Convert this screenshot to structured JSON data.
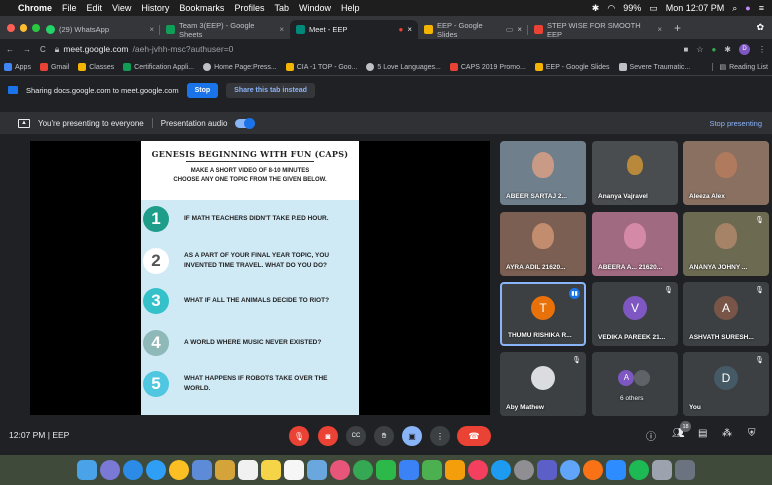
{
  "menubar": {
    "apple": "",
    "app": "Chrome",
    "items": [
      "File",
      "Edit",
      "View",
      "History",
      "Bookmarks",
      "Profiles",
      "Tab",
      "Window",
      "Help"
    ],
    "battery": "99%",
    "clock": "Mon 12:07 PM"
  },
  "tabs": [
    {
      "label": "(29) WhatsApp",
      "color": "#25d366"
    },
    {
      "label": "Team 3(EEP) - Google Sheets",
      "color": "#0f9d58"
    },
    {
      "label": "Meet - EEP",
      "color": "#00897b"
    },
    {
      "label": "EEP - Google Slides",
      "color": "#f4b400"
    },
    {
      "label": "STEP WISE FOR SMOOTH EEP",
      "color": "#ea4335"
    }
  ],
  "address": {
    "host": "meet.google.com",
    "path": "/aeh-jvhh-msc?authuser=0"
  },
  "bookmarks": [
    {
      "label": "Apps",
      "color": "#4285f4"
    },
    {
      "label": "Gmail",
      "color": "#ea4335"
    },
    {
      "label": "Classes",
      "color": "#f4b400"
    },
    {
      "label": "Certification Appli...",
      "color": "#0f9d58"
    },
    {
      "label": "Home Page:Press...",
      "color": "#bdc1c6"
    },
    {
      "label": "CIA -1 TOP - Goo...",
      "color": "#f4b400"
    },
    {
      "label": "5 Love Languages...",
      "color": "#bdc1c6"
    },
    {
      "label": "CAPS 2019 Promo...",
      "color": "#ea4335"
    },
    {
      "label": "EEP - Google Slides",
      "color": "#f4b400"
    },
    {
      "label": "Severe Traumatic...",
      "color": "#bdc1c6"
    }
  ],
  "reading_list": "Reading List",
  "sharing": {
    "text": "Sharing docs.google.com to meet.google.com",
    "stop": "Stop",
    "share_tab": "Share this tab instead"
  },
  "banner": {
    "presenting": "You're presenting to everyone",
    "audio": "Presentation audio",
    "stop": "Stop presenting"
  },
  "slide": {
    "title": "GENESIS BEGINNING WITH FUN (CAPS)",
    "sub1": "MAKE A SHORT VIDEO OF 8-10 MINUTES",
    "sub2": "CHOOSE ANY ONE TOPIC FROM THE GIVEN BELOW.",
    "items": [
      {
        "num": "1",
        "text": "IF MATH TEACHERS DIDN'T TAKE P.ED HOUR.",
        "color": "#1e9d8b"
      },
      {
        "num": "2",
        "text": "AS A PART OF YOUR FINAL YEAR TOPIC, YOU INVENTED TIME TRAVEL. WHAT DO YOU DO?",
        "color": "#ffffff"
      },
      {
        "num": "3",
        "text": "WHAT IF ALL THE ANIMALS DECIDE TO RIOT?",
        "color": "#35c1c9"
      },
      {
        "num": "4",
        "text": "A WORLD WHERE MUSIC NEVER EXISTED?",
        "color": "#8fb8b9"
      },
      {
        "num": "5",
        "text": "WHAT HAPPENS IF ROBOTS TAKE OVER THE WORLD.",
        "color": "#4fc7e0"
      }
    ]
  },
  "participants": [
    {
      "name": "ABEER SARTAJ 2...",
      "bg": "#6f7f8c",
      "kind": "video"
    },
    {
      "name": "Ananya Vajravel",
      "bg": "#4a4d50",
      "kind": "video"
    },
    {
      "name": "Aleeza Alex",
      "bg": "#8a7060",
      "kind": "video"
    },
    {
      "name": "AYRA ADIL 21620...",
      "bg": "#7a5f52",
      "kind": "video"
    },
    {
      "name": "ABEERA A... 21620...",
      "bg": "#a06a80",
      "kind": "video"
    },
    {
      "name": "ANANYA JOHNY ...",
      "bg": "#6d6a52",
      "kind": "video"
    },
    {
      "name": "THUMU RISHIKA R...",
      "initial": "T",
      "avatar": "#e8710a",
      "kind": "avatar"
    },
    {
      "name": "VEDIKA PAREEK 21...",
      "initial": "V",
      "avatar": "#7e57c2",
      "kind": "avatar"
    },
    {
      "name": "ASHVATH SURESH...",
      "initial": "A",
      "avatar": "#795548",
      "kind": "avatar"
    },
    {
      "name": "Aby Mathew",
      "kind": "photo"
    },
    {
      "name": "6 others",
      "kind": "group"
    },
    {
      "name": "You",
      "initial": "D",
      "avatar": "#455a64",
      "kind": "avatar"
    }
  ],
  "meeting": {
    "time": "12:07 PM",
    "code": "EEP",
    "people_count": "18"
  }
}
